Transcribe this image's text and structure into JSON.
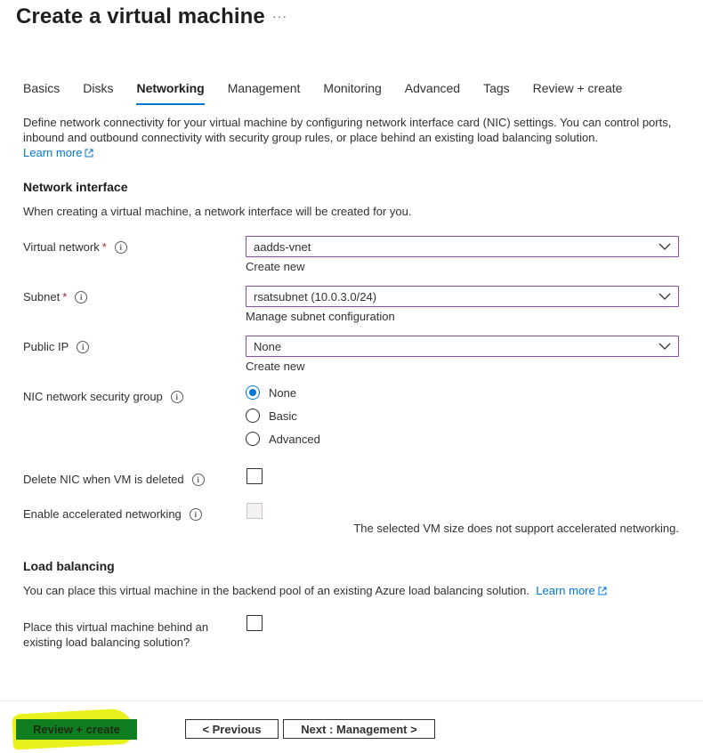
{
  "page": {
    "title": "Create a virtual machine",
    "more_label": "···"
  },
  "tabs": [
    {
      "label": "Basics"
    },
    {
      "label": "Disks"
    },
    {
      "label": "Networking",
      "active": true
    },
    {
      "label": "Management"
    },
    {
      "label": "Monitoring"
    },
    {
      "label": "Advanced"
    },
    {
      "label": "Tags"
    },
    {
      "label": "Review + create"
    }
  ],
  "description": {
    "text": "Define network connectivity for your virtual machine by configuring network interface card (NIC) settings. You can control ports, inbound and outbound connectivity with security group rules, or place behind an existing load balancing solution.",
    "learn_more": "Learn more"
  },
  "network_interface": {
    "title": "Network interface",
    "subtitle": "When creating a virtual machine, a network interface will be created for you.",
    "virtual_network": {
      "label": "Virtual network",
      "required": "*",
      "value": "aadds-vnet",
      "link": "Create new"
    },
    "subnet": {
      "label": "Subnet",
      "required": "*",
      "value": "rsatsubnet (10.0.3.0/24)",
      "link": "Manage subnet configuration"
    },
    "public_ip": {
      "label": "Public IP",
      "value": "None",
      "link": "Create new"
    },
    "nsg": {
      "label": "NIC network security group",
      "options": [
        "None",
        "Basic",
        "Advanced"
      ],
      "selected": "None"
    },
    "delete_nic": {
      "label": "Delete NIC when VM is deleted",
      "checked": false
    },
    "accel_net": {
      "label": "Enable accelerated networking",
      "checked": false,
      "disabled": true,
      "note": "The selected VM size does not support accelerated networking."
    }
  },
  "load_balancing": {
    "title": "Load balancing",
    "subtitle": "You can place this virtual machine in the backend pool of an existing Azure load balancing solution.",
    "learn_more": "Learn more",
    "place_behind": {
      "label_line1": "Place this virtual machine behind an",
      "label_line2": "existing load balancing solution?",
      "checked": false
    }
  },
  "footer": {
    "review_create": "Review + create",
    "previous": "< Previous",
    "next": "Next : Management >"
  },
  "colors": {
    "accent": "#0078d4",
    "dropdown_border": "#8a4f9e",
    "required": "#a4262c",
    "primary_button": "#0f7d20",
    "highlight": "#e9f11c"
  }
}
